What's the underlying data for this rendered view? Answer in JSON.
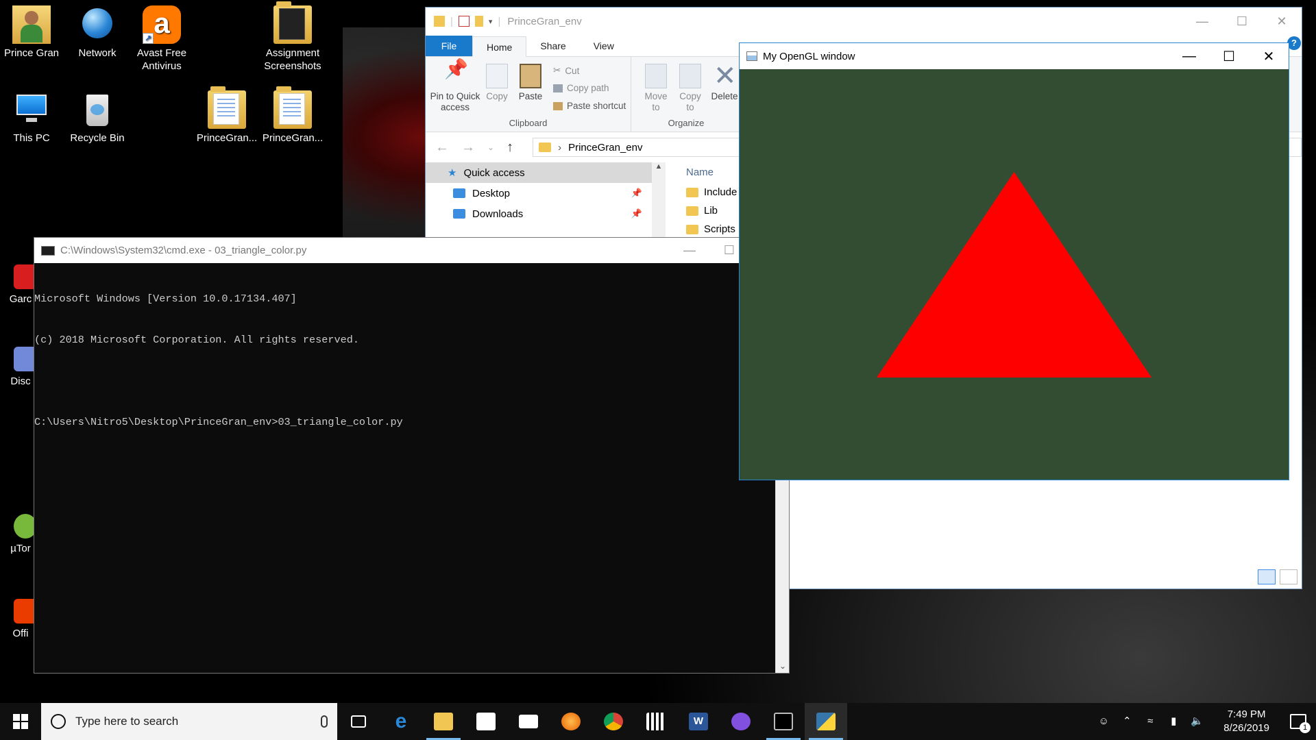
{
  "desktop": {
    "icons": [
      {
        "label": "Prince Gran"
      },
      {
        "label": "Network"
      },
      {
        "label": "Avast Free Antivirus"
      },
      {
        "label": "Assignment Screenshots"
      },
      {
        "label": "This PC"
      },
      {
        "label": "Recycle Bin"
      },
      {
        "label": "PrinceGran..."
      },
      {
        "label": "PrinceGran..."
      }
    ],
    "side_icons": [
      {
        "label": "Garc"
      },
      {
        "label": "Disc"
      },
      {
        "label": "µTor"
      },
      {
        "label": "Offi"
      }
    ]
  },
  "explorer": {
    "title": "PrinceGran_env",
    "tabs": [
      {
        "label": "File"
      },
      {
        "label": "Home"
      },
      {
        "label": "Share"
      },
      {
        "label": "View"
      }
    ],
    "ribbon": {
      "pin_label": "Pin to Quick access",
      "copy_label": "Copy",
      "paste_label": "Paste",
      "cut_label": "Cut",
      "copy_path_label": "Copy path",
      "paste_shortcut_label": "Paste shortcut",
      "clipboard_group": "Clipboard",
      "move_to_label": "Move to",
      "copy_to_label": "Copy to",
      "delete_label": "Delete",
      "organize_group": "Organize"
    },
    "address": {
      "path": "PrinceGran_env"
    },
    "nav": [
      {
        "label": "Quick access"
      },
      {
        "label": "Desktop"
      },
      {
        "label": "Downloads"
      }
    ],
    "column_name": "Name",
    "files": [
      {
        "name": "Include"
      },
      {
        "name": "Lib"
      },
      {
        "name": "Scripts"
      }
    ]
  },
  "cmd": {
    "title": "C:\\Windows\\System32\\cmd.exe - 03_triangle_color.py",
    "lines": [
      "Microsoft Windows [Version 10.0.17134.407]",
      "(c) 2018 Microsoft Corporation. All rights reserved.",
      "",
      "C:\\Users\\Nitro5\\Desktop\\PrinceGran_env>03_triangle_color.py"
    ]
  },
  "gl_window": {
    "title": "My OpenGL window",
    "background_color": "#334d33",
    "triangle_color": "#ff0000"
  },
  "taskbar": {
    "search_placeholder": "Type here to search",
    "time": "7:49 PM",
    "date": "8/26/2019",
    "notification_count": "1"
  }
}
